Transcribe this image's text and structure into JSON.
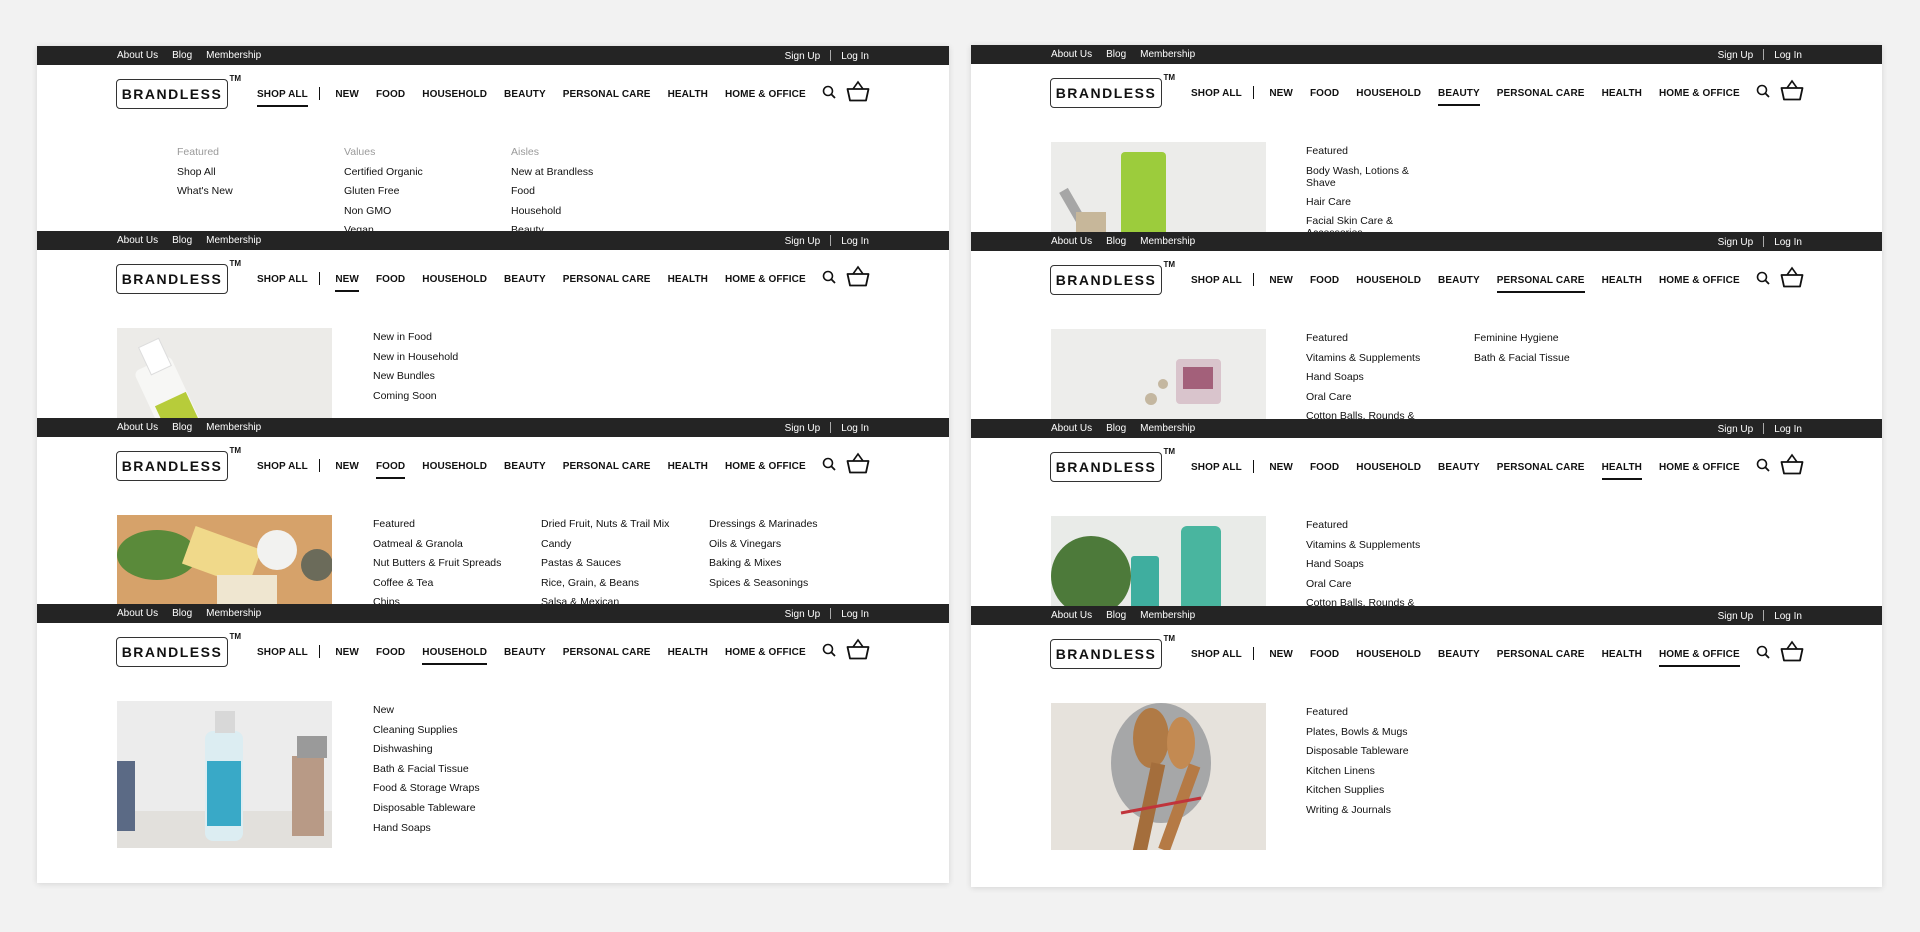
{
  "brand": {
    "logo_text": "BRANDLESS",
    "tm": "TM"
  },
  "utility": {
    "links": [
      "About Us",
      "Blog",
      "Membership"
    ],
    "sign_up": "Sign Up",
    "log_in": "Log In"
  },
  "nav": [
    "SHOP ALL",
    "NEW",
    "FOOD",
    "HOUSEHOLD",
    "BEAUTY",
    "PERSONAL CARE",
    "HEALTH",
    "HOME & OFFICE"
  ],
  "panels": {
    "shop_all": {
      "active": "SHOP ALL",
      "columns": [
        {
          "heading": "Featured",
          "items": [
            "Shop All",
            "What's New"
          ]
        },
        {
          "heading": "Values",
          "items": [
            "Certified Organic",
            "Gluten Free",
            "Non GMO",
            "Vegan"
          ]
        },
        {
          "heading": "Aisles",
          "items": [
            "New at Brandless",
            "Food",
            "Household",
            "Beauty"
          ]
        }
      ]
    },
    "new": {
      "active": "NEW",
      "columns": [
        {
          "items": [
            "New in Food",
            "New in Household",
            "New Bundles",
            "Coming Soon"
          ]
        }
      ]
    },
    "food": {
      "active": "FOOD",
      "columns": [
        {
          "items": [
            "Featured",
            "Oatmeal & Granola",
            "Nut Butters & Fruit Spreads",
            "Coffee & Tea",
            "Chips"
          ]
        },
        {
          "items": [
            "Dried Fruit, Nuts & Trail Mix",
            "Candy",
            "Pastas & Sauces",
            "Rice, Grain, & Beans",
            "Salsa & Mexican"
          ]
        },
        {
          "items": [
            "Dressings & Marinades",
            "Oils & Vinegars",
            "Baking & Mixes",
            "Spices & Seasonings"
          ]
        }
      ]
    },
    "household": {
      "active": "HOUSEHOLD",
      "columns": [
        {
          "items": [
            "New",
            "Cleaning Supplies",
            "Dishwashing",
            "Bath & Facial Tissue",
            "Food & Storage Wraps",
            "Disposable Tableware",
            "Hand Soaps"
          ]
        }
      ]
    },
    "beauty": {
      "active": "BEAUTY",
      "columns": [
        {
          "items": [
            "Featured",
            "Body Wash, Lotions & Shave",
            "Hair Care",
            "Facial Skin Care & Accessories"
          ]
        }
      ]
    },
    "personal_care": {
      "active": "PERSONAL CARE",
      "columns": [
        {
          "items": [
            "Featured",
            "Vitamins & Supplements",
            "Hand Soaps",
            "Oral Care",
            "Cotton Balls, Rounds &"
          ]
        },
        {
          "items": [
            "Feminine Hygiene",
            "Bath & Facial Tissue"
          ]
        }
      ]
    },
    "health": {
      "active": "HEALTH",
      "columns": [
        {
          "items": [
            "Featured",
            "Vitamins & Supplements",
            "Hand Soaps",
            "Oral Care",
            "Cotton Balls, Rounds &"
          ]
        }
      ]
    },
    "home_office": {
      "active": "HOME & OFFICE",
      "columns": [
        {
          "items": [
            "Featured",
            "Plates, Bowls & Mugs",
            "Disposable Tableware",
            "Kitchen Linens",
            "Kitchen Supplies",
            "Writing & Journals"
          ]
        }
      ]
    }
  },
  "colors": {
    "utility_bar": "#242424",
    "page_bg": "#f2f2f2",
    "muted_heading": "#9a9a9a"
  },
  "icons": [
    "search-icon",
    "basket-icon"
  ]
}
